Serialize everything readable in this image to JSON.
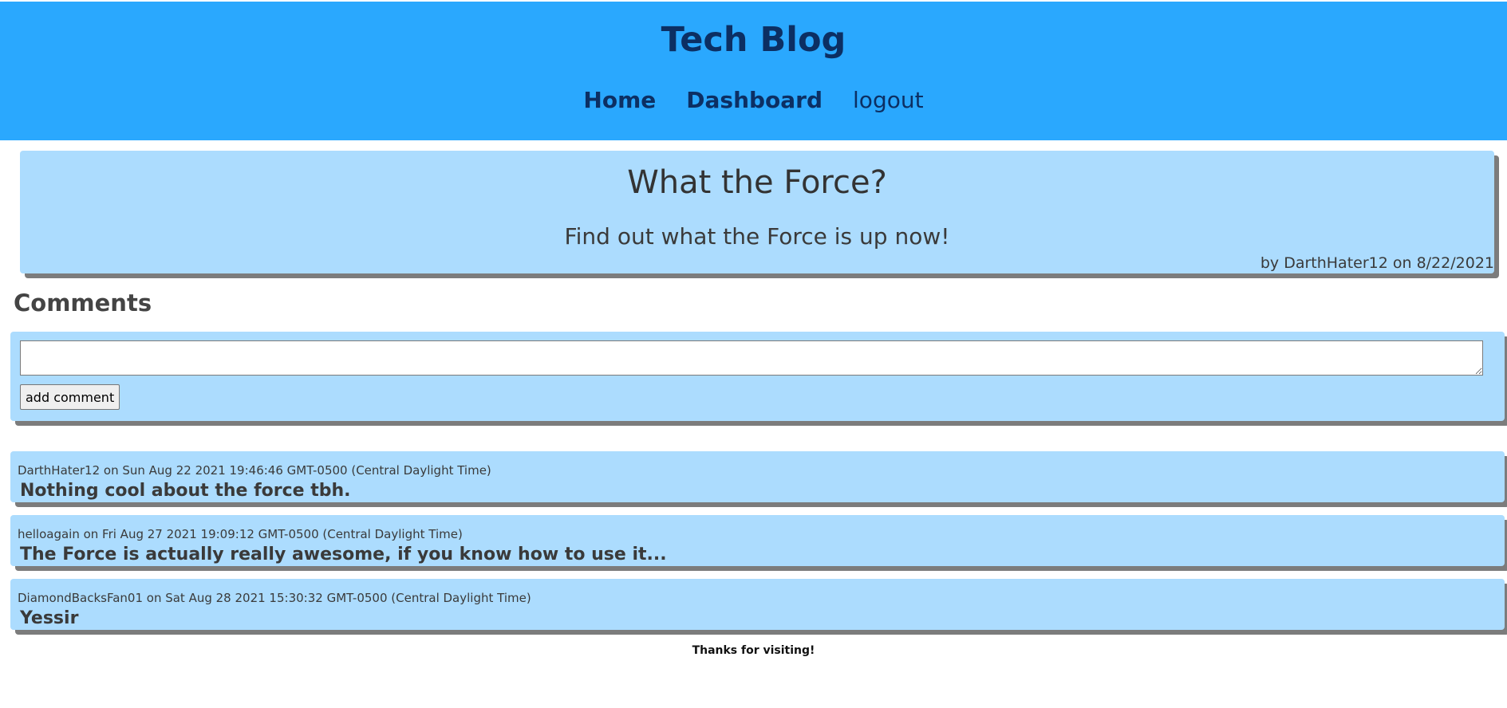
{
  "header": {
    "title": "Tech Blog",
    "nav": {
      "home": "Home",
      "dashboard": "Dashboard",
      "logout": "logout"
    }
  },
  "post": {
    "title": "What the Force?",
    "body": "Find out what the Force is up now!",
    "meta": "by DarthHater12 on 8/22/2021"
  },
  "comments_section": {
    "heading": "Comments",
    "input_value": "",
    "add_button_label": "add comment",
    "items": [
      {
        "meta": "DarthHater12 on Sun Aug 22 2021 19:46:46 GMT-0500 (Central Daylight Time)",
        "text": "Nothing cool about the force tbh."
      },
      {
        "meta": "helloagain on Fri Aug 27 2021 19:09:12 GMT-0500 (Central Daylight Time)",
        "text": "The Force is actually really awesome, if you know how to use it..."
      },
      {
        "meta": "DiamondBacksFan01 on Sat Aug 28 2021 15:30:32 GMT-0500 (Central Daylight Time)",
        "text": "Yessir"
      }
    ]
  },
  "footer": {
    "text": "Thanks for visiting!"
  },
  "colors": {
    "header_bg": "#2aa8fe",
    "card_bg": "#acdcfe",
    "title_text": "#0c2f63",
    "shadow": "#7c7c7c"
  }
}
